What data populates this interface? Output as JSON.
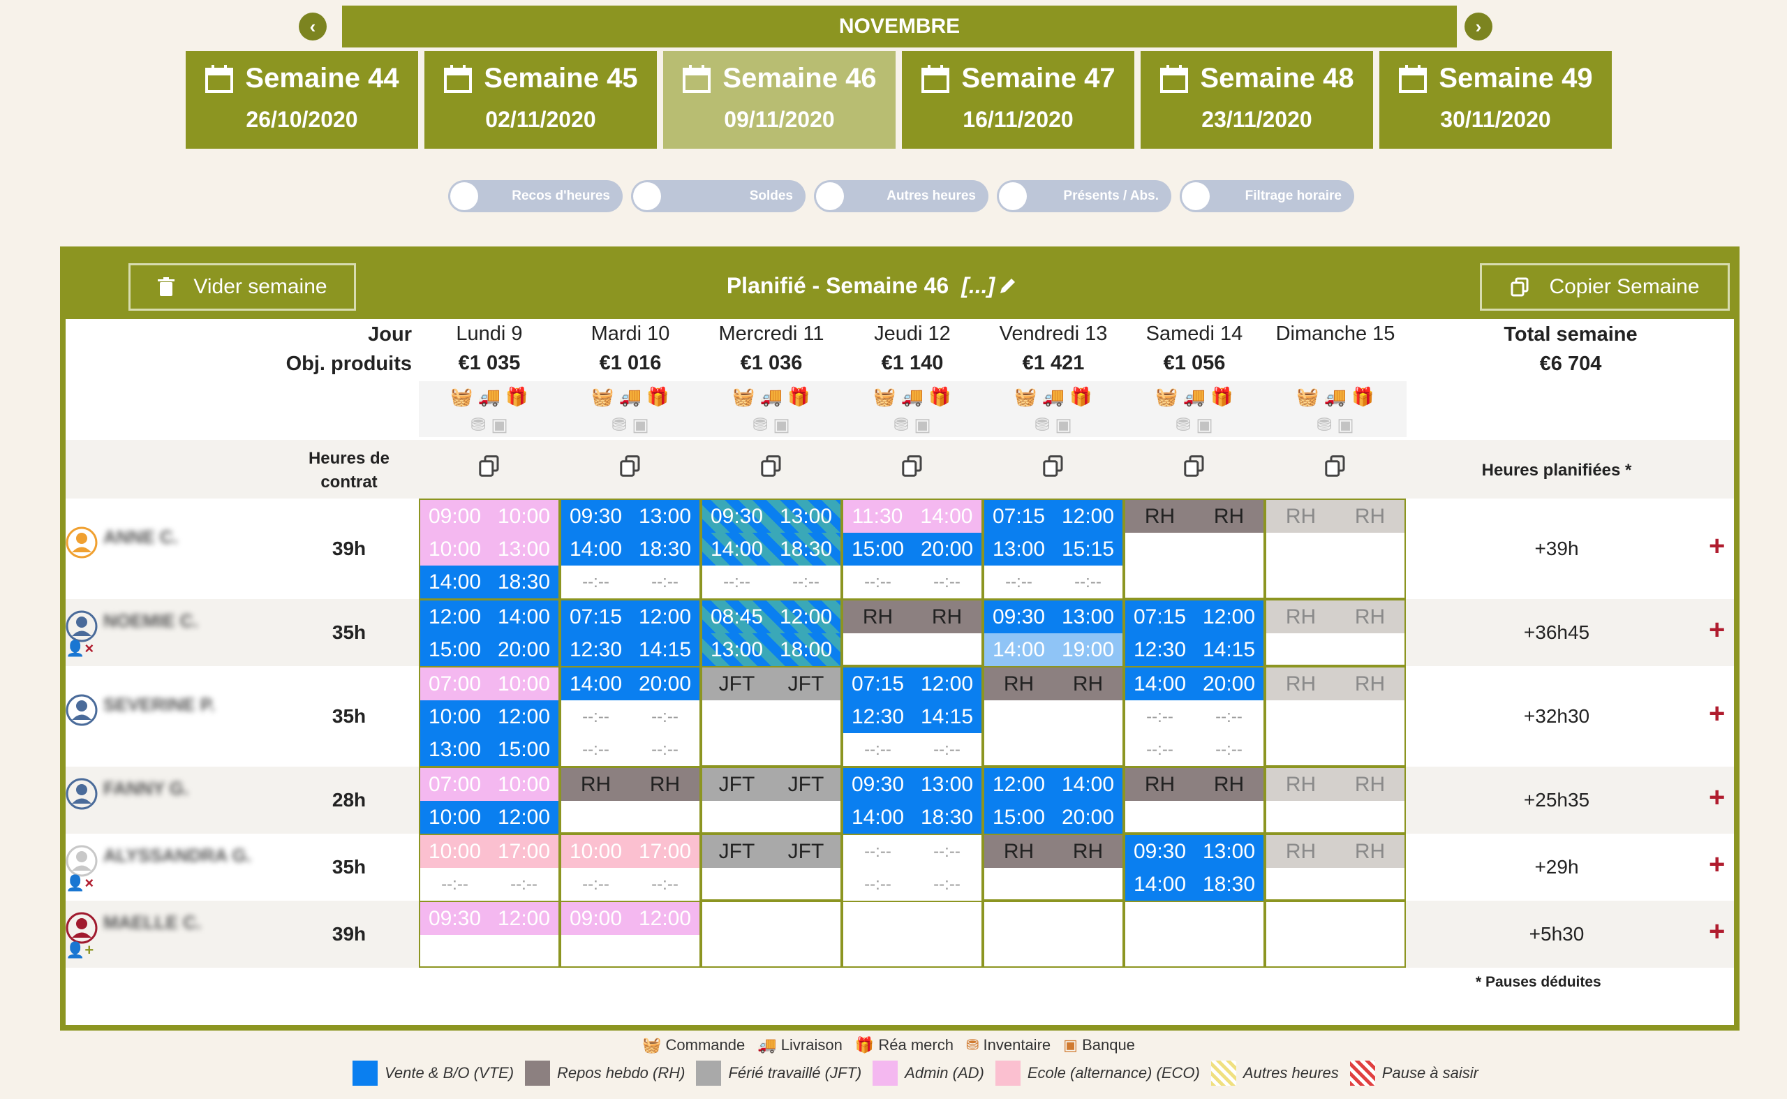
{
  "month": "NOVEMBRE",
  "weeks": [
    {
      "label": "Semaine 44",
      "date": "26/10/2020"
    },
    {
      "label": "Semaine 45",
      "date": "02/11/2020"
    },
    {
      "label": "Semaine 46",
      "date": "09/11/2020",
      "active": true
    },
    {
      "label": "Semaine 47",
      "date": "16/11/2020"
    },
    {
      "label": "Semaine 48",
      "date": "23/11/2020"
    },
    {
      "label": "Semaine 49",
      "date": "30/11/2020"
    }
  ],
  "toggles": [
    "Recos d'heures",
    "Soldes",
    "Autres heures",
    "Présents / Abs.",
    "Filtrage horaire"
  ],
  "panel": {
    "clear_week": "Vider semaine",
    "title": "Planifié - Semaine 46",
    "title_suffix": "[...]",
    "copy_week": "Copier Semaine",
    "jour_label": "Jour",
    "obj_label": "Obj. produits",
    "contract_label": "Heures de contrat",
    "total_label": "Total semaine",
    "total_value": "€6 704",
    "planned_label": "Heures planifiées *",
    "footnote": "* Pauses déduites"
  },
  "days": [
    {
      "name": "Lundi 9",
      "obj": "€1 035"
    },
    {
      "name": "Mardi 10",
      "obj": "€1 016"
    },
    {
      "name": "Mercredi 11",
      "obj": "€1 036"
    },
    {
      "name": "Jeudi 12",
      "obj": "€1 140"
    },
    {
      "name": "Vendredi 13",
      "obj": "€1 421"
    },
    {
      "name": "Samedi 14",
      "obj": "€1 056"
    },
    {
      "name": "Dimanche 15",
      "obj": ""
    }
  ],
  "employees": [
    {
      "name": "ANNE C.",
      "contract": "39h",
      "planned": "+39h",
      "avatar": "#f0a030",
      "badge": "",
      "days": [
        [
          [
            "09:00",
            "10:00",
            "ad"
          ],
          [
            "10:00",
            "13:00",
            "ad"
          ],
          [
            "14:00",
            "18:30",
            "vte"
          ]
        ],
        [
          [
            "09:30",
            "13:00",
            "vte"
          ],
          [
            "14:00",
            "18:30",
            "vte"
          ],
          [
            "--:--",
            "--:--",
            "empty"
          ]
        ],
        [
          [
            "09:30",
            "13:00",
            "eco"
          ],
          [
            "14:00",
            "18:30",
            "eco"
          ],
          [
            "--:--",
            "--:--",
            "empty"
          ]
        ],
        [
          [
            "11:30",
            "14:00",
            "ad"
          ],
          [
            "15:00",
            "20:00",
            "vte"
          ],
          [
            "--:--",
            "--:--",
            "empty"
          ]
        ],
        [
          [
            "07:15",
            "12:00",
            "vte"
          ],
          [
            "13:00",
            "15:15",
            "vte"
          ],
          [
            "--:--",
            "--:--",
            "empty"
          ]
        ],
        [
          [
            "RH",
            "RH",
            "rh"
          ]
        ],
        [
          [
            "RH",
            "RH",
            "rhl"
          ]
        ]
      ]
    },
    {
      "name": "NOEMIE C.",
      "contract": "35h",
      "planned": "+36h45",
      "avatar": "#4a6b9a",
      "badge": "remove",
      "days": [
        [
          [
            "12:00",
            "14:00",
            "vte"
          ],
          [
            "15:00",
            "20:00",
            "vte"
          ]
        ],
        [
          [
            "07:15",
            "12:00",
            "vte"
          ],
          [
            "12:30",
            "14:15",
            "vte"
          ]
        ],
        [
          [
            "08:45",
            "12:00",
            "eco"
          ],
          [
            "13:00",
            "18:00",
            "eco"
          ]
        ],
        [
          [
            "RH",
            "RH",
            "rh"
          ]
        ],
        [
          [
            "09:30",
            "13:00",
            "vte"
          ],
          [
            "14:00",
            "19:00",
            "vtel"
          ]
        ],
        [
          [
            "07:15",
            "12:00",
            "vte"
          ],
          [
            "12:30",
            "14:15",
            "vte"
          ]
        ],
        [
          [
            "RH",
            "RH",
            "rhl"
          ]
        ]
      ]
    },
    {
      "name": "SEVERINE P.",
      "contract": "35h",
      "planned": "+32h30",
      "avatar": "#4a6b9a",
      "badge": "",
      "days": [
        [
          [
            "07:00",
            "10:00",
            "ad"
          ],
          [
            "10:00",
            "12:00",
            "vte"
          ],
          [
            "13:00",
            "15:00",
            "vte"
          ]
        ],
        [
          [
            "14:00",
            "20:00",
            "vte"
          ],
          [
            "--:--",
            "--:--",
            "empty"
          ],
          [
            "--:--",
            "--:--",
            "empty"
          ]
        ],
        [
          [
            "JFT",
            "JFT",
            "jft"
          ]
        ],
        [
          [
            "07:15",
            "12:00",
            "vte"
          ],
          [
            "12:30",
            "14:15",
            "vte"
          ],
          [
            "--:--",
            "--:--",
            "empty"
          ]
        ],
        [
          [
            "RH",
            "RH",
            "rh"
          ]
        ],
        [
          [
            "14:00",
            "20:00",
            "vte"
          ],
          [
            "--:--",
            "--:--",
            "empty"
          ],
          [
            "--:--",
            "--:--",
            "empty"
          ]
        ],
        [
          [
            "RH",
            "RH",
            "rhl"
          ]
        ]
      ]
    },
    {
      "name": "FANNY G.",
      "contract": "28h",
      "planned": "+25h35",
      "avatar": "#4a6b9a",
      "badge": "",
      "days": [
        [
          [
            "07:00",
            "10:00",
            "ad"
          ],
          [
            "10:00",
            "12:00",
            "vte"
          ]
        ],
        [
          [
            "RH",
            "RH",
            "rh"
          ]
        ],
        [
          [
            "JFT",
            "JFT",
            "jft"
          ]
        ],
        [
          [
            "09:30",
            "13:00",
            "vte"
          ],
          [
            "14:00",
            "18:30",
            "vte"
          ]
        ],
        [
          [
            "12:00",
            "14:00",
            "vte"
          ],
          [
            "15:00",
            "20:00",
            "vte"
          ]
        ],
        [
          [
            "RH",
            "RH",
            "rh"
          ]
        ],
        [
          [
            "RH",
            "RH",
            "rhl"
          ]
        ]
      ]
    },
    {
      "name": "ALYSSANDRA G.",
      "contract": "35h",
      "planned": "+29h",
      "avatar": "#c8c8c8",
      "badge": "remove",
      "days": [
        [
          [
            "10:00",
            "17:00",
            "ecop"
          ],
          [
            "--:--",
            "--:--",
            "empty"
          ]
        ],
        [
          [
            "10:00",
            "17:00",
            "ecop"
          ],
          [
            "--:--",
            "--:--",
            "empty"
          ]
        ],
        [
          [
            "JFT",
            "JFT",
            "jft"
          ]
        ],
        [
          [
            "--:--",
            "--:--",
            "empty"
          ],
          [
            "--:--",
            "--:--",
            "empty"
          ]
        ],
        [
          [
            "RH",
            "RH",
            "rh"
          ]
        ],
        [
          [
            "09:30",
            "13:00",
            "vte"
          ],
          [
            "14:00",
            "18:30",
            "vte"
          ]
        ],
        [
          [
            "RH",
            "RH",
            "rhl"
          ]
        ]
      ]
    },
    {
      "name": "MAELLE C.",
      "contract": "39h",
      "planned": "+5h30",
      "avatar": "#a01a2e",
      "badge": "add",
      "days": [
        [
          [
            "09:30",
            "12:00",
            "ad"
          ]
        ],
        [
          [
            "09:00",
            "12:00",
            "ad"
          ]
        ],
        [],
        [],
        [],
        [],
        []
      ]
    }
  ],
  "legend_icons": [
    {
      "icon": "basket-icon",
      "label": "Commande"
    },
    {
      "icon": "truck-icon",
      "label": "Livraison"
    },
    {
      "icon": "gift-icon",
      "label": "Réa merch"
    },
    {
      "icon": "coins-icon",
      "label": "Inventaire"
    },
    {
      "icon": "banknote-icon",
      "label": "Banque"
    }
  ],
  "legend_colors": [
    {
      "color": "#0a7ff0",
      "label": "Vente & B/O (VTE)"
    },
    {
      "color": "#8c8080",
      "label": "Repos hebdo (RH)"
    },
    {
      "color": "#a9a9a9",
      "label": "Férié travaillé (JFT)"
    },
    {
      "color": "#f4b8f0",
      "label": "Admin (AD)"
    },
    {
      "color": "#fbc0d0",
      "label": "Ecole (alternance) (ECO)"
    },
    {
      "color": "hatch-yellow",
      "label": "Autres heures"
    },
    {
      "color": "hatch-red",
      "label": "Pause à saisir"
    }
  ],
  "colors": {
    "olive": "#8c9521",
    "vte": "#0a7ff0",
    "rh": "#8c8080",
    "jft": "#a9a9a9",
    "ad": "#f4b8f0",
    "plus": "#b01c2e"
  }
}
